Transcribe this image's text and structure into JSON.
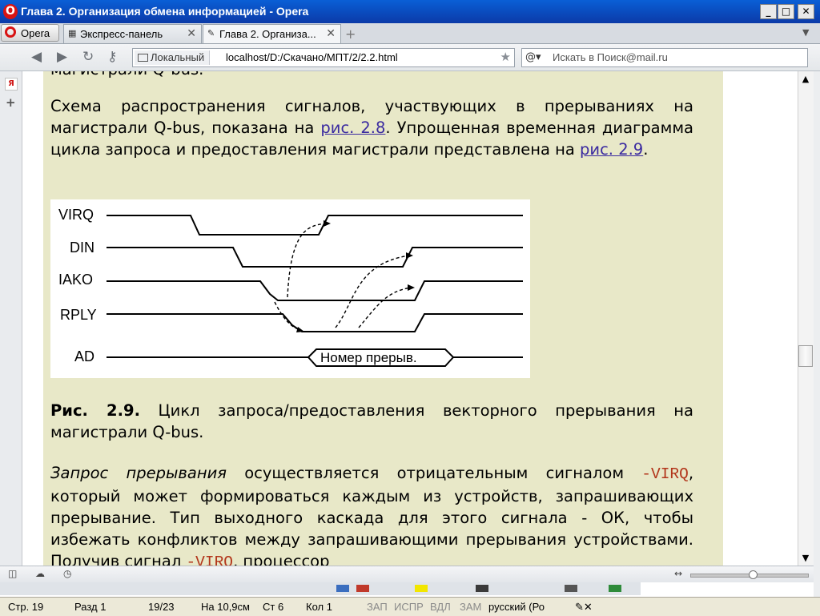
{
  "window": {
    "title": "Глава 2. Организация обмена информацией - Opera",
    "minimize": "_",
    "maximize": "□",
    "close": "✕"
  },
  "tabs": {
    "menu_label": "Opera",
    "items": [
      {
        "label": "Экспресс-панель",
        "icon": "grid-icon"
      },
      {
        "label": "Глава 2. Организа...",
        "icon": "page-icon"
      }
    ],
    "close_glyph": "✕",
    "new_tab_glyph": "+"
  },
  "address": {
    "local_label": "Локальный",
    "url": "localhost/D:/Скачано/МПТ/2/2.2.html",
    "search_placeholder": "Искать в Поиск@mail.ru"
  },
  "sidebar": {
    "ya_label": "Я",
    "add_glyph": "+"
  },
  "content": {
    "partial_top": "магистрали Q-bus.",
    "para1": {
      "text_a": "Схема распространения сигналов, участвующих в прерываниях на магистрали Q-bus, показана на ",
      "link1": "рис. 2.8",
      "text_b": ". Упрощенная временная диаграмма цикла запроса и предоставления магистрали представлена на ",
      "link2": "рис. 2.9",
      "text_c": "."
    },
    "figure": {
      "signals": [
        "VIRQ",
        "DIN",
        "IAKO",
        "RPLY",
        "AD"
      ],
      "ad_label": "Номер прерыв."
    },
    "caption": {
      "label": "Рис. 2.9.",
      "text": " Цикл запроса/предоставления векторного прерывания на магистрали Q-bus."
    },
    "para2": {
      "italic": "Запрос прерывания",
      "text_a": " осуществляется отрицательным сигналом ",
      "signal": "-VIRQ",
      "text_b": ", который может формироваться каждым из устройств, запрашивающих прерывание. Тип выходного каскада для этого сигнала - ОК, чтобы избежать конфликтов между запрашивающими прерывания устройствами. Получив сигнал ",
      "signal2": "-VIRQ",
      "text_c": ", процессор"
    }
  },
  "scrollbar": {
    "up": "▲",
    "down": "▼"
  },
  "word_status": {
    "page": "Стр. 19",
    "section": "Разд 1",
    "pages": "19/23",
    "position": "На 10,9см",
    "line": "Ст 6",
    "col": "Кол 1",
    "rec": "ЗАП",
    "trk": "ИСПР",
    "ext": "ВДЛ",
    "ovr": "ЗАМ",
    "lang": "русский (Ро"
  }
}
